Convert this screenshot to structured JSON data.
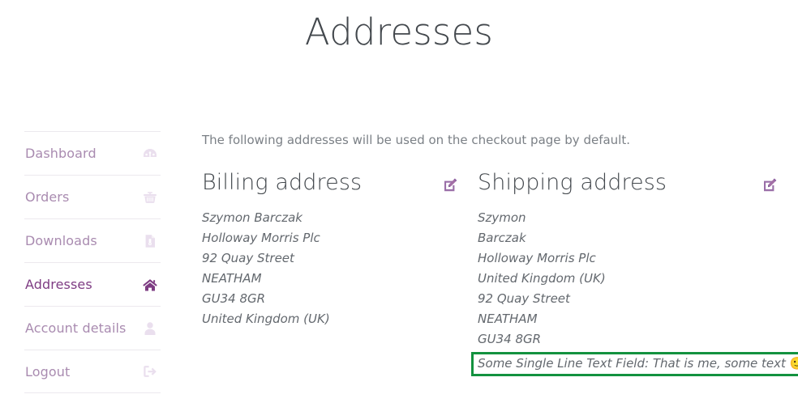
{
  "page": {
    "title": "Addresses"
  },
  "sidebar": {
    "items": [
      {
        "label": "Dashboard",
        "icon": "dashboard-gauge-icon",
        "active": false
      },
      {
        "label": "Orders",
        "icon": "shopping-basket-icon",
        "active": false
      },
      {
        "label": "Downloads",
        "icon": "download-file-icon",
        "active": false
      },
      {
        "label": "Addresses",
        "icon": "home-house-icon",
        "active": true
      },
      {
        "label": "Account details",
        "icon": "user-person-icon",
        "active": false
      },
      {
        "label": "Logout",
        "icon": "sign-out-icon",
        "active": false
      }
    ]
  },
  "main": {
    "intro": "The following addresses will be used on the checkout page by default.",
    "billing": {
      "title": "Billing address",
      "edit_icon": "edit-pencil-square-icon",
      "lines": [
        "Szymon Barczak",
        "Holloway Morris Plc",
        "92 Quay Street",
        "NEATHAM",
        "GU34 8GR",
        "United Kingdom (UK)"
      ]
    },
    "shipping": {
      "title": "Shipping address",
      "edit_icon": "edit-pencil-square-icon",
      "lines": [
        "Szymon",
        "Barczak",
        "Holloway Morris Plc",
        "United Kingdom (UK)",
        "92 Quay Street",
        "NEATHAM",
        "GU34 8GR"
      ],
      "highlighted_line": "Some Single Line Text Field: That is me, some text",
      "highlighted_emoji": "🙂"
    }
  },
  "colors": {
    "title": "#43484d",
    "nav_inactive": "#a98bb0",
    "nav_active": "#7e3c83",
    "body_text": "#63686e",
    "intro_text": "#7b8086",
    "highlight_border": "#13923f",
    "divider": "#ece9ee"
  }
}
